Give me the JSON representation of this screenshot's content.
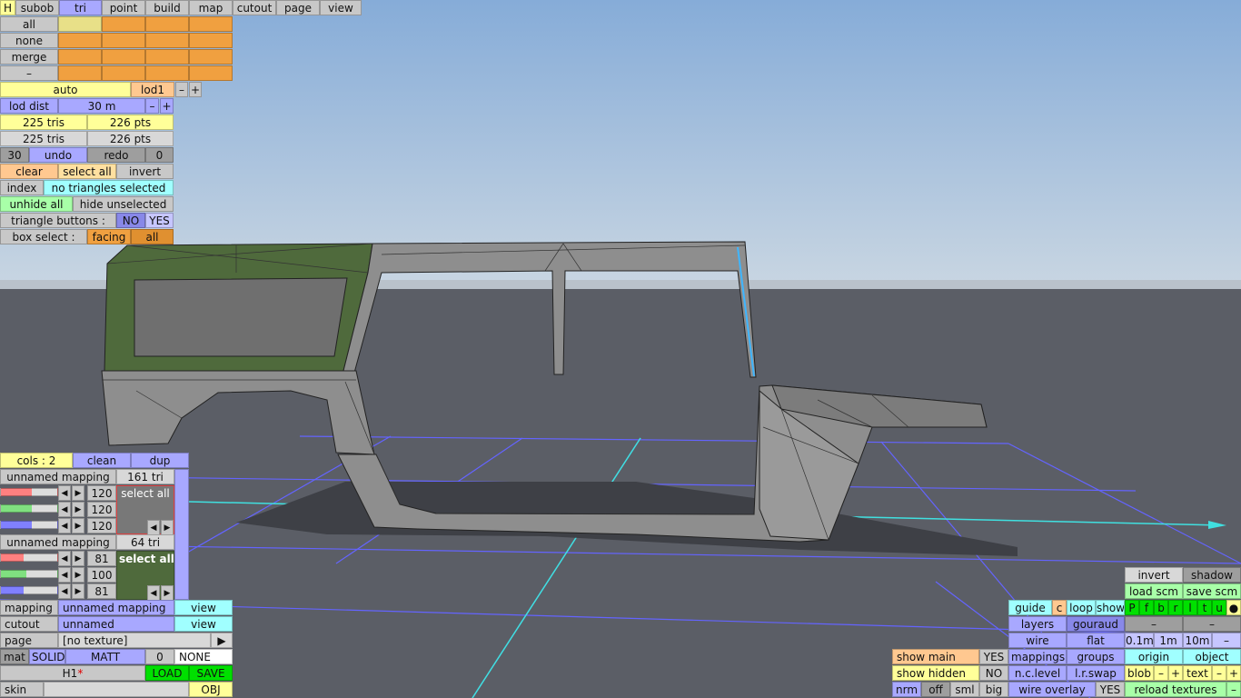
{
  "top_tabs": [
    "H",
    "subob",
    "tri",
    "point",
    "build",
    "map",
    "cutout",
    "page",
    "view"
  ],
  "subob": {
    "labels": [
      "all",
      "none",
      "merge",
      "–"
    ]
  },
  "lod": {
    "auto": "auto",
    "level": "lod1",
    "minus": "–",
    "plus": "+",
    "dist_label": "lod dist",
    "dist_value": "30 m"
  },
  "counts": {
    "tris1": "225 tris",
    "pts1": "226 pts",
    "tris2": "225 tris",
    "pts2": "226 pts"
  },
  "history": {
    "steps": "30",
    "undo": "undo",
    "redo": "redo",
    "redo_count": "0"
  },
  "select": {
    "clear": "clear",
    "select_all": "select all",
    "invert": "invert",
    "index": "index",
    "status": "no triangles selected",
    "unhide": "unhide all",
    "hide": "hide unselected"
  },
  "triangle_buttons": {
    "label": "triangle buttons :",
    "no": "NO",
    "yes": "YES"
  },
  "box_select": {
    "label": "box select :",
    "facing": "facing",
    "all": "all"
  },
  "mapping_panel": {
    "cols": "cols : 2",
    "clean": "clean",
    "dup": "dup",
    "mappings": [
      {
        "name": "unnamed mapping",
        "tris": "161 tri",
        "values": [
          "120",
          "120",
          "120"
        ],
        "select": "select all"
      },
      {
        "name": "unnamed mapping",
        "tris": "64 tri",
        "values": [
          "81",
          "100",
          "81"
        ],
        "select": "select all"
      }
    ]
  },
  "bottom_left": {
    "mapping_label": "mapping",
    "mapping_value": "unnamed mapping",
    "view1": "view",
    "cutout_label": "cutout",
    "cutout_value": "unnamed",
    "view2": "view",
    "page_label": "page",
    "page_value": "[no texture]",
    "page_arrow": "▶",
    "mat": "mat",
    "solid": "SOLID",
    "matt": "MATT",
    "mat_num": "0",
    "mat_none": "NONE",
    "object_name": "H1",
    "modified": "*",
    "load": "LOAD",
    "save": "SAVE",
    "skin": "skin",
    "obj": "OBJ"
  },
  "right_panel": {
    "invert": "invert",
    "shadow": "shadow",
    "load_scm": "load scm",
    "save_scm": "save scm",
    "guide": "guide",
    "c": "c",
    "loop": "loop",
    "show": "show",
    "flags": [
      "P",
      "f",
      "b",
      "r",
      "l",
      "t",
      "u",
      "●"
    ],
    "layers": "layers",
    "gouraud": "gouraud",
    "dash1": "–",
    "dash2": "–",
    "wire": "wire",
    "flat": "flat",
    "g01": "0.1m",
    "g1": "1m",
    "g10": "10m",
    "gdash": "–",
    "mappings": "mappings",
    "groups": "groups",
    "origin": "origin",
    "object": "object",
    "nclevel": "n.c.level",
    "lrswap": "l.r.swap",
    "blob": "blob",
    "text": "text",
    "minus": "–",
    "plus": "+",
    "wire_overlay": "wire overlay",
    "wire_overlay_val": "YES",
    "reload": "reload textures",
    "reload_dash": "–"
  },
  "show_panel": {
    "show_main": "show main",
    "show_main_val": "YES",
    "show_hidden": "show hidden",
    "show_hidden_val": "NO",
    "nrm": "nrm",
    "off": "off",
    "sml": "sml",
    "big": "big"
  },
  "colors": {
    "sky_top": "#8fb4de",
    "sky_bottom": "#c8d8e8",
    "ground": "#5b5e66",
    "model": "#8e8e8e",
    "selected": "#4f6a3c",
    "grid": "#6a6aff",
    "axis": "#40e0e0"
  }
}
